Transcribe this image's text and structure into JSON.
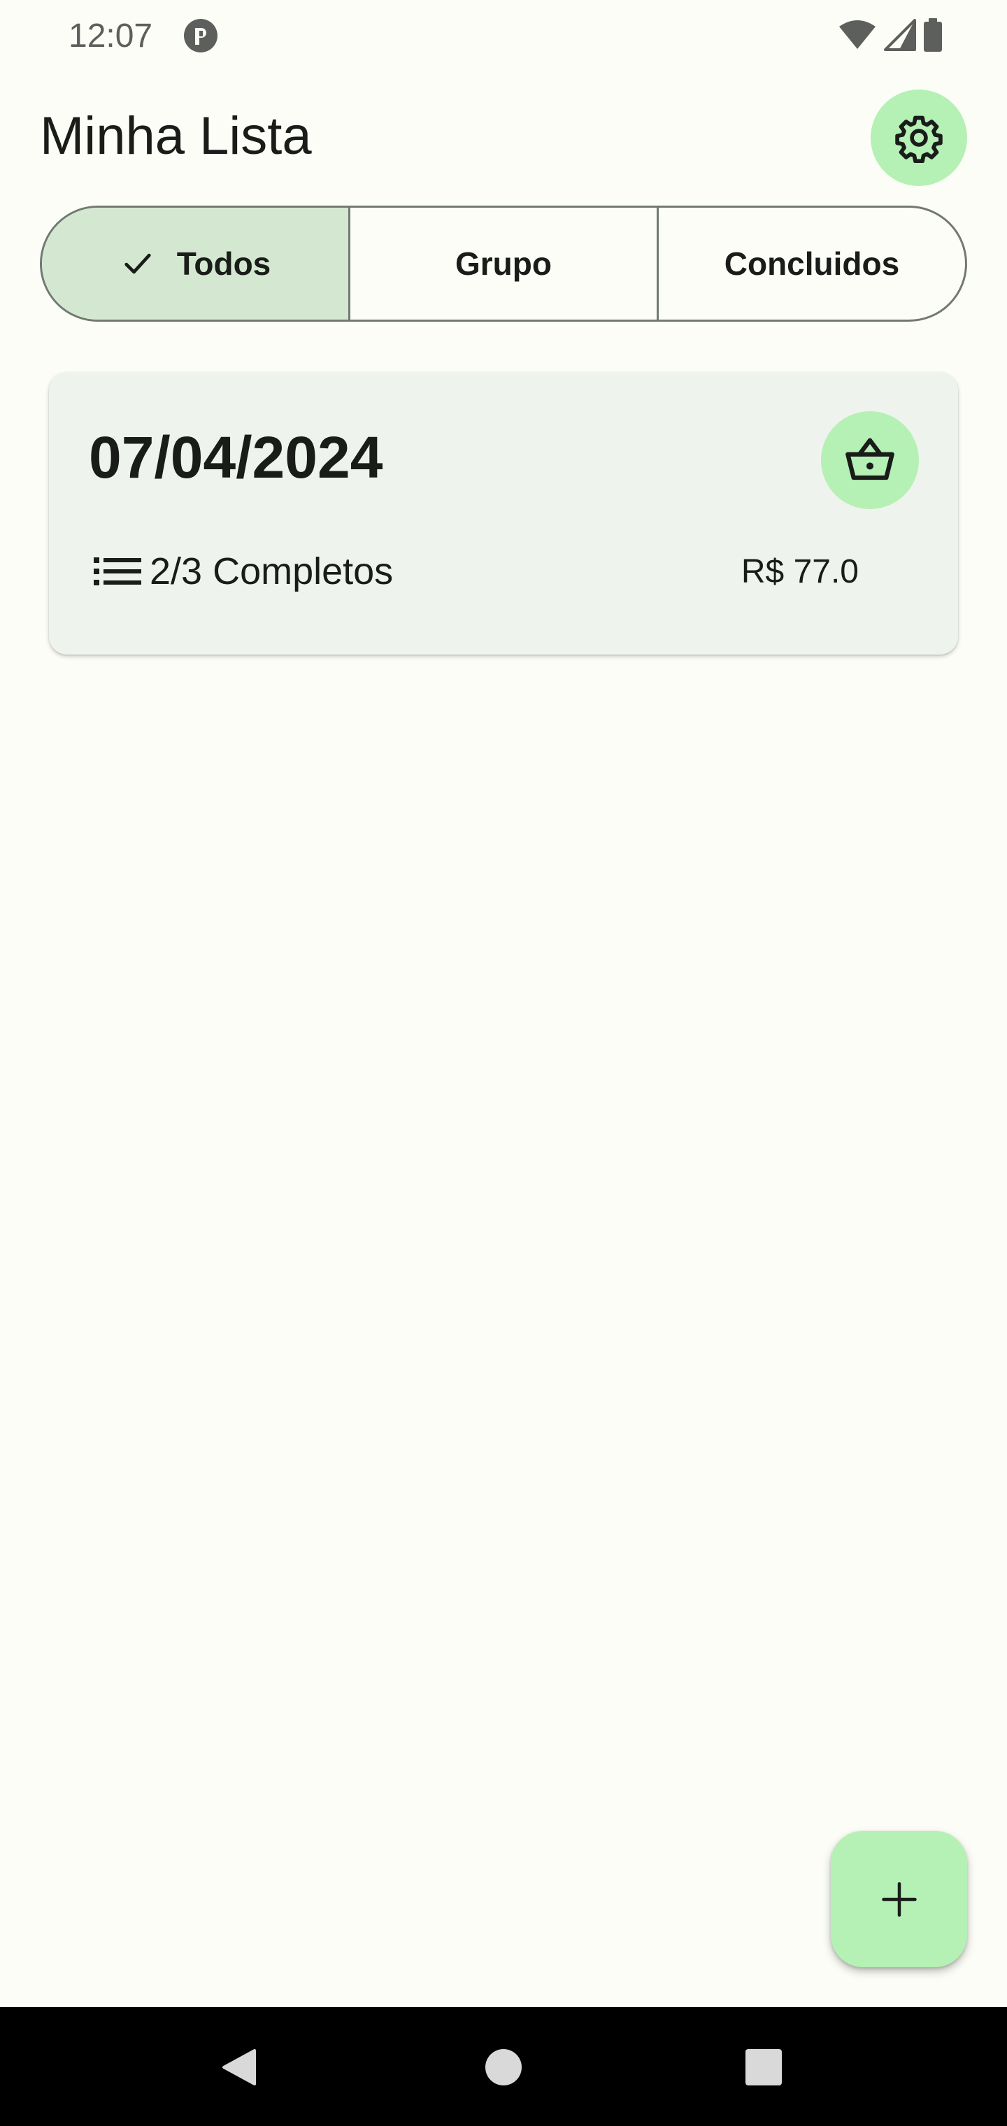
{
  "status_bar": {
    "time": "12:07",
    "icons": [
      "app-notification-icon",
      "wifi-icon",
      "signal-icon",
      "battery-icon"
    ]
  },
  "header": {
    "title": "Minha Lista",
    "settings_icon": "gear-icon"
  },
  "tabs": [
    {
      "label": "Todos",
      "selected": true
    },
    {
      "label": "Grupo",
      "selected": false
    },
    {
      "label": "Concluidos",
      "selected": false
    }
  ],
  "lists": [
    {
      "date": "07/04/2024",
      "progress": "2/3 Completos",
      "price": "R$ 77.0",
      "icon": "basket-icon"
    }
  ],
  "fab": {
    "icon": "plus-icon"
  },
  "nav": {
    "icons": [
      "back-icon",
      "home-icon",
      "recents-icon"
    ]
  },
  "colors": {
    "background": "#fbfdf6",
    "accent": "#b5f0b5",
    "selected_segment": "#d4e8d1",
    "card": "#eff3ed",
    "text": "#191c19"
  }
}
